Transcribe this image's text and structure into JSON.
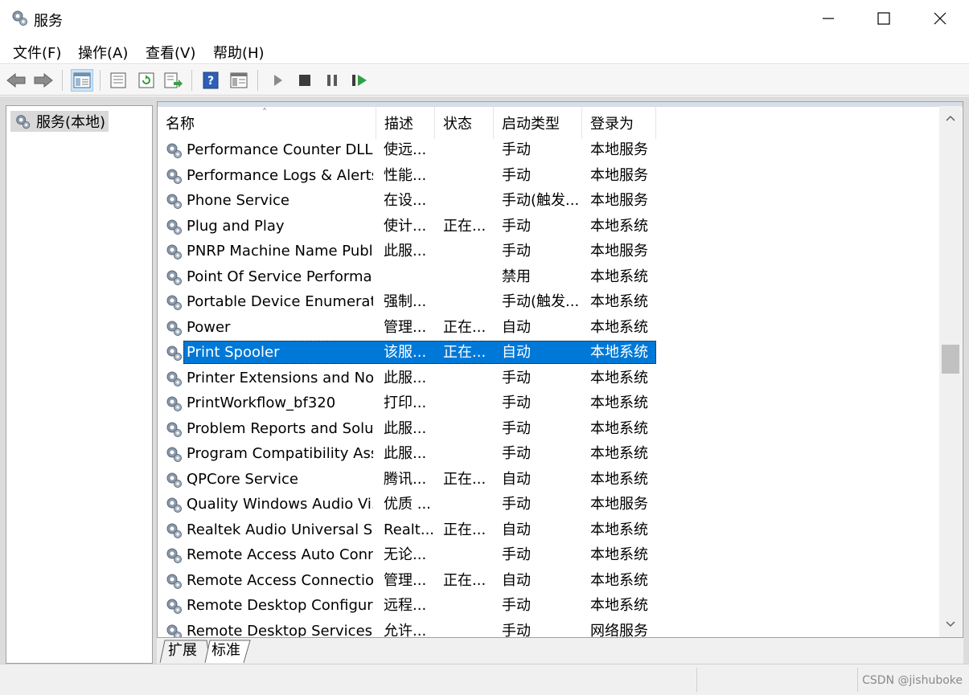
{
  "window": {
    "title": "服务"
  },
  "menu": [
    "文件(F)",
    "操作(A)",
    "查看(V)",
    "帮助(H)"
  ],
  "toolbar_icons": [
    "back-icon",
    "forward-icon",
    "console-tree-icon",
    "properties-icon",
    "refresh-icon",
    "export-list-icon",
    "help-icon",
    "view-icon",
    "start-service-icon",
    "stop-service-icon",
    "pause-service-icon",
    "restart-service-icon"
  ],
  "tree": {
    "root_label": "服务(本地)"
  },
  "columns": {
    "name": "名称",
    "desc": "描述",
    "status": "状态",
    "startup": "启动类型",
    "logon": "登录为"
  },
  "rows": [
    {
      "name": "Performance Counter DLL ...",
      "desc": "使远...",
      "status": "",
      "startup": "手动",
      "logon": "本地服务"
    },
    {
      "name": "Performance Logs & Alerts",
      "desc": "性能...",
      "status": "",
      "startup": "手动",
      "logon": "本地服务"
    },
    {
      "name": "Phone Service",
      "desc": "在设...",
      "status": "",
      "startup": "手动(触发...",
      "logon": "本地服务"
    },
    {
      "name": "Plug and Play",
      "desc": "使计...",
      "status": "正在...",
      "startup": "手动",
      "logon": "本地系统"
    },
    {
      "name": "PNRP Machine Name Publ...",
      "desc": "此服...",
      "status": "",
      "startup": "手动",
      "logon": "本地服务"
    },
    {
      "name": "Point Of Service Performa...",
      "desc": "",
      "status": "",
      "startup": "禁用",
      "logon": "本地系统"
    },
    {
      "name": "Portable Device Enumerat...",
      "desc": "强制...",
      "status": "",
      "startup": "手动(触发...",
      "logon": "本地系统"
    },
    {
      "name": "Power",
      "desc": "管理...",
      "status": "正在...",
      "startup": "自动",
      "logon": "本地系统"
    },
    {
      "name": "Print Spooler",
      "desc": "该服...",
      "status": "正在...",
      "startup": "自动",
      "logon": "本地系统",
      "selected": true
    },
    {
      "name": "Printer Extensions and Noti...",
      "desc": "此服...",
      "status": "",
      "startup": "手动",
      "logon": "本地系统"
    },
    {
      "name": "PrintWorkflow_bf320",
      "desc": "打印...",
      "status": "",
      "startup": "手动",
      "logon": "本地系统"
    },
    {
      "name": "Problem Reports and Solut...",
      "desc": "此服...",
      "status": "",
      "startup": "手动",
      "logon": "本地系统"
    },
    {
      "name": "Program Compatibility Assi...",
      "desc": "此服...",
      "status": "",
      "startup": "手动",
      "logon": "本地系统"
    },
    {
      "name": "QPCore Service",
      "desc": "腾讯...",
      "status": "正在...",
      "startup": "自动",
      "logon": "本地系统"
    },
    {
      "name": "Quality Windows Audio Vi...",
      "desc": "优质 ...",
      "status": "",
      "startup": "手动",
      "logon": "本地服务"
    },
    {
      "name": "Realtek Audio Universal Se...",
      "desc": "Realt...",
      "status": "正在...",
      "startup": "自动",
      "logon": "本地系统"
    },
    {
      "name": "Remote Access Auto Conn...",
      "desc": "无论...",
      "status": "",
      "startup": "手动",
      "logon": "本地系统"
    },
    {
      "name": "Remote Access Connectio...",
      "desc": "管理...",
      "status": "正在...",
      "startup": "自动",
      "logon": "本地系统"
    },
    {
      "name": "Remote Desktop Configur...",
      "desc": "远程...",
      "status": "",
      "startup": "手动",
      "logon": "本地系统"
    },
    {
      "name": "Remote Desktop Services",
      "desc": "允许...",
      "status": "",
      "startup": "手动",
      "logon": "网络服务"
    }
  ],
  "tabs": [
    "扩展",
    "标准"
  ],
  "watermark": "CSDN @jishuboke"
}
